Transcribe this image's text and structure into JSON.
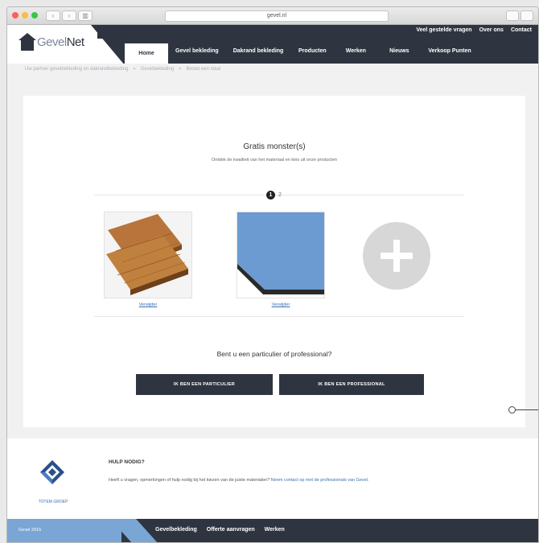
{
  "browser": {
    "url": "gevel.nl"
  },
  "logo": {
    "text_light": "Gevel",
    "text_bold": "Net"
  },
  "toplinks": [
    "Veel gestelde vragen",
    "Over ons",
    "Contact"
  ],
  "nav": [
    {
      "label": "Home",
      "active": true
    },
    {
      "label": "Gevel bekleding",
      "active": false
    },
    {
      "label": "Dakrand bekleding",
      "active": false
    },
    {
      "label": "Producten",
      "active": false
    },
    {
      "label": "Werken",
      "active": false
    },
    {
      "label": "Nieuws",
      "active": false
    },
    {
      "label": "Verkoop Punten",
      "active": false
    }
  ],
  "breadcrumb": [
    "Uw partner gevelbekleding en dakrandbekleding",
    "Gevelbekleding",
    "Bestel een staal"
  ],
  "main": {
    "title": "Gratis monster(s)",
    "subtitle": "Ontdek de kwaliteit van het materiaal en kies uit onze producten",
    "step_active": "1",
    "step_next": "2",
    "samples": [
      {
        "link": "Verwijder",
        "kind": "wood"
      },
      {
        "link": "Verwijder",
        "kind": "panel",
        "color": "#6b9bd1"
      }
    ],
    "question": "Bent u een particulier of professional?",
    "btn_particulier": "IK BEN EEN PARTICULIER",
    "btn_professional": "IK BEN EEN PROFESSIONAL"
  },
  "help": {
    "brand": "TOTEM GROEP",
    "title": "HULP NODIG?",
    "text": "Heeft u vragen, opmerkingen of hulp nodig bij het kiezen van de juiste materialen?",
    "link": "Neem contact op met de professionals van Gevel."
  },
  "footer": {
    "copyright": "Gevel 2015",
    "links": [
      "Gevelbekleding",
      "Offerte aanvragen",
      "Werken"
    ]
  },
  "colors": {
    "navy": "#2f3540",
    "accent_blue": "#7aa6d6",
    "panel_blue": "#6b9bd1"
  }
}
